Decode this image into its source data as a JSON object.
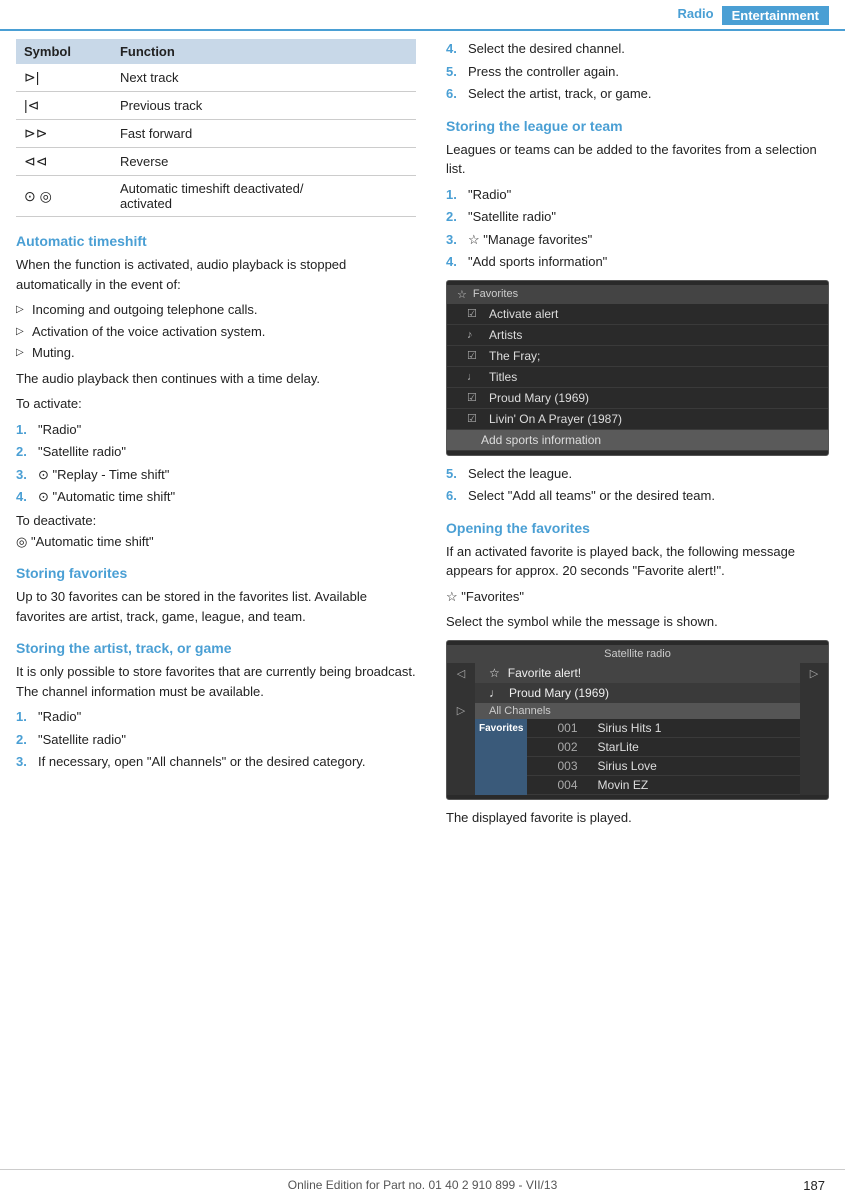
{
  "header": {
    "radio_label": "Radio",
    "entertainment_label": "Entertainment"
  },
  "table": {
    "col1": "Symbol",
    "col2": "Function",
    "rows": [
      {
        "symbol": "⊳|",
        "function": "Next track"
      },
      {
        "symbol": "|⊲",
        "function": "Previous track"
      },
      {
        "symbol": "⊳⊳",
        "function": "Fast forward"
      },
      {
        "symbol": "⊲⊲",
        "function": "Reverse"
      },
      {
        "symbol": "⊙  ◎",
        "function": "Automatic timeshift deactivated/activated"
      }
    ]
  },
  "auto_timeshift": {
    "title": "Automatic timeshift",
    "intro": "When the function is activated, audio playback is stopped automatically in the event of:",
    "bullets": [
      "Incoming and outgoing telephone calls.",
      "Activation of the voice activation system.",
      "Muting."
    ],
    "continues": "The audio playback then continues with a time delay.",
    "activate_label": "To activate:",
    "activate_steps": [
      {
        "num": "1.",
        "text": "\"Radio\""
      },
      {
        "num": "2.",
        "text": "\"Satellite radio\""
      },
      {
        "num": "3.",
        "text": "⊙ \"Replay - Time shift\""
      },
      {
        "num": "4.",
        "text": "⊙ \"Automatic time shift\""
      }
    ],
    "deactivate_label": "To deactivate:",
    "deactivate_step": "◎ \"Automatic time shift\""
  },
  "storing_favorites": {
    "title": "Storing favorites",
    "body": "Up to 30 favorites can be stored in the favorites list. Available favorites are artist, track, game, league, and team."
  },
  "storing_artist": {
    "title": "Storing the artist, track, or game",
    "body": "It is only possible to store favorites that are currently being broadcast. The channel information must be available.",
    "steps": [
      {
        "num": "1.",
        "text": "\"Radio\""
      },
      {
        "num": "2.",
        "text": "\"Satellite radio\""
      },
      {
        "num": "3.",
        "text": "If necessary, open \"All channels\" or the desired category."
      }
    ]
  },
  "right_col": {
    "step4": "Select the desired channel.",
    "step5": "Press the controller again.",
    "step6": "Select the artist, track, or game.",
    "storing_league": {
      "title": "Storing the league or team",
      "body": "Leagues or teams can be added to the favorites from a selection list.",
      "steps": [
        {
          "num": "1.",
          "text": "\"Radio\""
        },
        {
          "num": "2.",
          "text": "\"Satellite radio\""
        },
        {
          "num": "3.",
          "text": "☆ \"Manage favorites\""
        },
        {
          "num": "4.",
          "text": "\"Add sports information\""
        }
      ],
      "screenshot": {
        "header": "Favorites",
        "rows": [
          {
            "icon": "☑",
            "text": "Activate alert",
            "type": "normal"
          },
          {
            "icon": "♪",
            "text": "Artists",
            "type": "normal"
          },
          {
            "icon": "☑",
            "text": "The Fray;",
            "type": "normal"
          },
          {
            "icon": "♩",
            "text": "Titles",
            "type": "normal"
          },
          {
            "icon": "☑",
            "text": "Proud Mary (1969)",
            "type": "normal"
          },
          {
            "icon": "☑",
            "text": "Livin' On A Prayer (1987)",
            "type": "normal"
          },
          {
            "icon": "",
            "text": "Add sports information",
            "type": "highlighted"
          }
        ]
      },
      "step5": "Select the league.",
      "step6": "Select \"Add all teams\" or the desired team."
    },
    "opening_favorites": {
      "title": "Opening the favorites",
      "body1": "If an activated favorite is played back, the following message appears for approx. 20 seconds \"Favorite alert!\".",
      "step_fav": "☆ \"Favorites\"",
      "body2": "Select the symbol while the message is shown.",
      "screenshot": {
        "header": "Satellite radio",
        "alert_rows": [
          {
            "icon": "☆",
            "text": "Favorite alert!"
          },
          {
            "icon": "♩",
            "text": "Proud Mary (1969)"
          }
        ],
        "channels_header": "All Channels",
        "fav_label": "Favorites",
        "channels": [
          {
            "num": "001",
            "name": "Sirius Hits 1"
          },
          {
            "num": "002",
            "name": "StarLite"
          },
          {
            "num": "003",
            "name": "Sirius Love"
          },
          {
            "num": "004",
            "name": "Movin EZ"
          }
        ]
      },
      "body3": "The displayed favorite is played."
    }
  },
  "footer": {
    "text": "Online Edition for Part no. 01 40 2 910 899 - VII/13",
    "page": "187"
  }
}
